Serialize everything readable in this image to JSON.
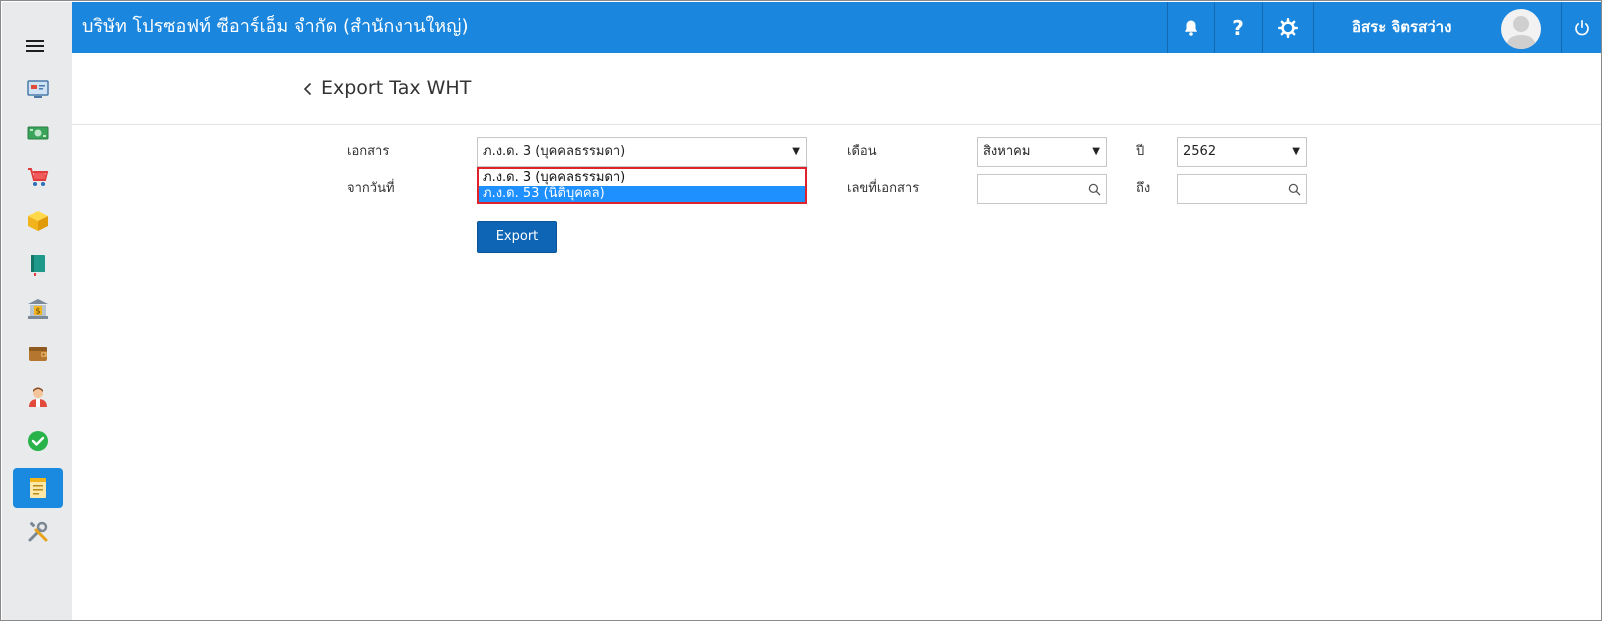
{
  "header": {
    "company": "บริษัท โปรซอฟท์ ซีอาร์เอ็ม จำกัด (สำนักงานใหญ่)",
    "username": "อิสระ จิตรสว่าง",
    "help_label": "?"
  },
  "sidebar": {
    "items": [
      {
        "icon": "dashboard-icon"
      },
      {
        "icon": "money-icon"
      },
      {
        "icon": "shopping-cart-icon"
      },
      {
        "icon": "box-icon"
      },
      {
        "icon": "ledger-book-icon"
      },
      {
        "icon": "bank-icon"
      },
      {
        "icon": "wallet-icon"
      },
      {
        "icon": "person-icon"
      },
      {
        "icon": "check-circle-icon"
      },
      {
        "icon": "tax-report-icon",
        "active": true
      },
      {
        "icon": "tools-icon"
      }
    ]
  },
  "page": {
    "title": "Export Tax WHT"
  },
  "form": {
    "document_label": "เอกสาร",
    "document_value": "ภ.ง.ด. 3 (บุคคลธรรมดา)",
    "document_options": [
      "ภ.ง.ด. 3 (บุคคลธรรมดา)",
      "ภ.ง.ด. 53 (นิติบุคคล)"
    ],
    "from_date_label": "จากวันที่",
    "month_label": "เดือน",
    "month_value": "สิงหาคม",
    "year_label": "ปี",
    "year_value": "2562",
    "doc_no_label": "เลขที่เอกสาร",
    "to_label": "ถึง",
    "doc_no_from_value": "",
    "doc_no_to_value": "",
    "export_label": "Export"
  },
  "colors": {
    "topbar": "#1a86de",
    "active_sidebar": "#1a8ae0",
    "export_button": "#0f65b5",
    "dropdown_highlight": "#1e90ff",
    "dropdown_border": "#e0232a"
  }
}
